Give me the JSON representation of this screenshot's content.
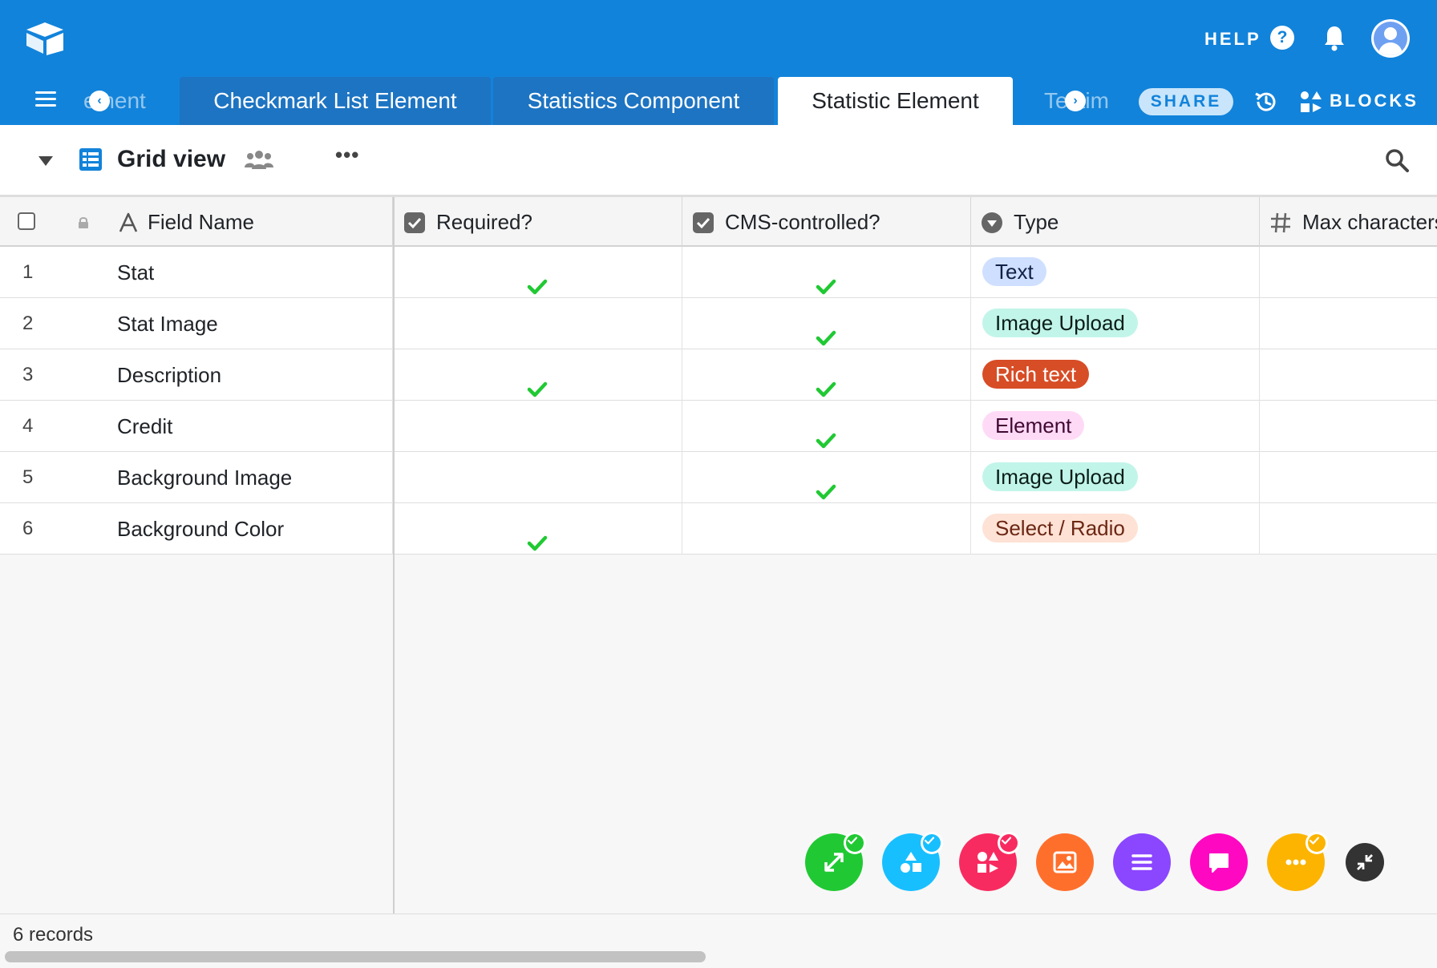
{
  "topbar": {
    "help_label": "HELP",
    "help_icon_glyph": "?",
    "share_label": "SHARE",
    "blocks_label": "BLOCKS",
    "tabs": [
      {
        "label": "ement",
        "state": "faded"
      },
      {
        "label": "Checkmark List Element",
        "state": "normal"
      },
      {
        "label": "Statistics Component",
        "state": "normal"
      },
      {
        "label": "Statistic Element",
        "state": "active"
      },
      {
        "label": "Testim",
        "state": "faded"
      }
    ],
    "scroll_left_glyph": "‹",
    "scroll_right_glyph": "›",
    "icons": [
      "airtable-logo-icon",
      "help-icon",
      "bell-icon",
      "avatar-icon",
      "menu-icon",
      "history-icon",
      "blocks-icon"
    ]
  },
  "viewbar": {
    "view_name": "Grid view",
    "more_glyph": "•••",
    "icons": [
      "caret-down-icon",
      "grid-view-icon",
      "people-icon",
      "more-icon",
      "search-icon"
    ]
  },
  "grid": {
    "columns": [
      {
        "label": "Field Name",
        "icon": "text-field-icon"
      },
      {
        "label": "Required?",
        "icon": "checkbox-field-icon"
      },
      {
        "label": "CMS-controlled?",
        "icon": "checkbox-field-icon"
      },
      {
        "label": "Type",
        "icon": "single-select-icon"
      },
      {
        "label": "Max characters",
        "icon": "number-field-icon"
      }
    ],
    "rows": [
      {
        "num": "1",
        "field_name": "Stat",
        "required": true,
        "cms": true,
        "type": "Text"
      },
      {
        "num": "2",
        "field_name": "Stat Image",
        "required": false,
        "cms": true,
        "type": "Image Upload"
      },
      {
        "num": "3",
        "field_name": "Description",
        "required": true,
        "cms": true,
        "type": "Rich text"
      },
      {
        "num": "4",
        "field_name": "Credit",
        "required": false,
        "cms": true,
        "type": "Element"
      },
      {
        "num": "5",
        "field_name": "Background Image",
        "required": false,
        "cms": true,
        "type": "Image Upload"
      },
      {
        "num": "6",
        "field_name": "Background Color",
        "required": true,
        "cms": false,
        "type": "Select / Radio"
      }
    ],
    "footer": {
      "record_count": "6 records"
    }
  },
  "type_colors": {
    "Text": {
      "bg": "#cfdfff",
      "fg": "#102046"
    },
    "Image Upload": {
      "bg": "#c2f5e9",
      "fg": "#0b1d18"
    },
    "Rich text": {
      "bg": "#d74d26",
      "fg": "#ffffff"
    },
    "Element": {
      "bg": "#ffdaf6",
      "fg": "#400832"
    },
    "Select / Radio": {
      "bg": "#fee2d5",
      "fg": "#6b2613"
    }
  },
  "colors": {
    "brand_blue": "#1283da",
    "check_green": "#20c933"
  },
  "dock": [
    {
      "name": "expand-block",
      "icon": "expand-arrows-icon",
      "color": "#20c933",
      "checked": true
    },
    {
      "name": "shapes-block",
      "icon": "shapes-icon",
      "color": "#18bfff",
      "checked": true
    },
    {
      "name": "apps-block",
      "icon": "apps-icon",
      "color": "#f82b60",
      "checked": true
    },
    {
      "name": "image-block",
      "icon": "image-icon",
      "color": "#ff6f2c",
      "checked": false
    },
    {
      "name": "list-block",
      "icon": "list-icon",
      "color": "#8b46ff",
      "checked": false
    },
    {
      "name": "chat-block",
      "icon": "chat-icon",
      "color": "#ff08c2",
      "checked": false
    },
    {
      "name": "more-block",
      "icon": "more-dots-icon",
      "color": "#fcb400",
      "checked": true
    },
    {
      "name": "collapse-block",
      "icon": "collapse-arrows-icon",
      "color": "#333333",
      "checked": false
    }
  ]
}
